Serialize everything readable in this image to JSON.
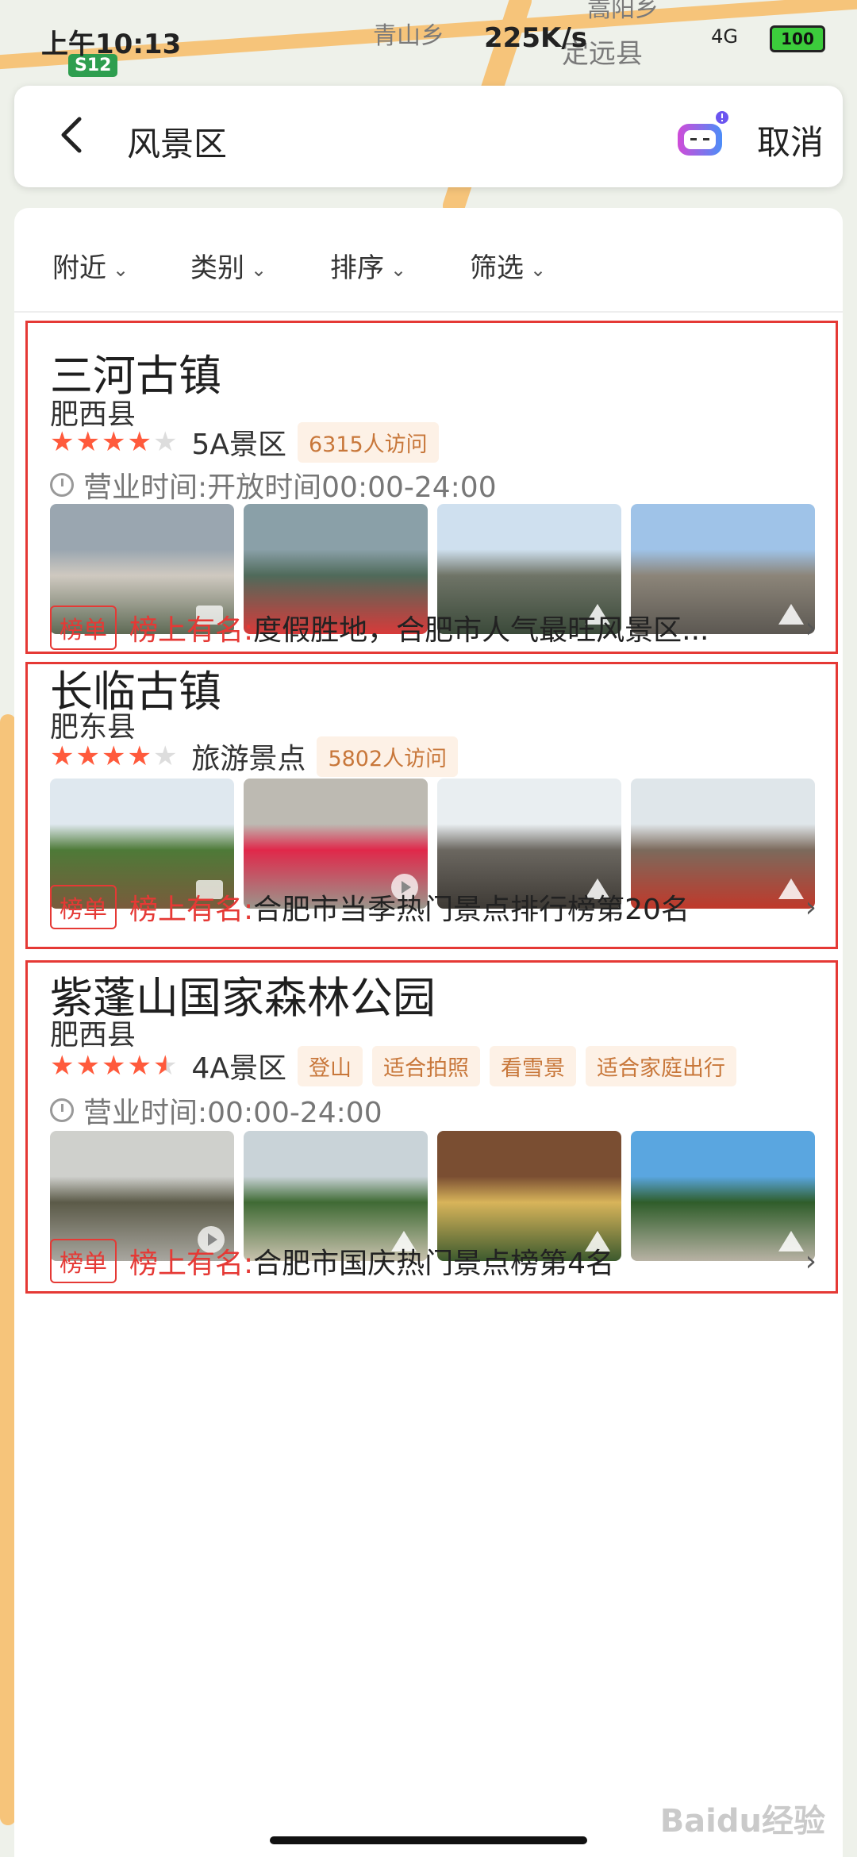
{
  "status_bar": {
    "time": "上午10:13",
    "network_speed": "225K/s",
    "signal": "4G",
    "battery": "100"
  },
  "map": {
    "labels": [
      "青山乡",
      "定远县",
      "嵩阳乡"
    ],
    "road_badge": "S12"
  },
  "header": {
    "title": "风景区",
    "cancel": "取消"
  },
  "filters": [
    "附近",
    "类别",
    "排序",
    "筛选"
  ],
  "results": [
    {
      "name": "三河古镇",
      "district": "肥西县",
      "rating": 4,
      "level": "5A景区",
      "chips": [
        "6315人访问"
      ],
      "hours": "营业时间:开放时间00:00-24:00",
      "photos": [
        {
          "colors": [
            "#9aa6b0",
            "#cfc9c0",
            "#5e6a55"
          ],
          "badge": "image"
        },
        {
          "colors": [
            "#8aa0a8",
            "#4f6a5a",
            "#d83a3a"
          ],
          "badge": "none"
        },
        {
          "colors": [
            "#cfe0ef",
            "#6f7467",
            "#3b4a3a"
          ],
          "badge": "mountain"
        },
        {
          "colors": [
            "#9fc3e8",
            "#8c8579",
            "#5c5852"
          ],
          "badge": "mountain"
        }
      ],
      "rank_tag": "榜单",
      "rank_label": "榜上有名:",
      "rank_text": "度假胜地，合肥市人气最旺风景区..."
    },
    {
      "name": "长临古镇",
      "district": "肥东县",
      "rating": 4,
      "level": "旅游景点",
      "chips": [
        "5802人访问"
      ],
      "hours": "",
      "photos": [
        {
          "colors": [
            "#dfe8ef",
            "#4e7a38",
            "#7a5b3c"
          ],
          "badge": "image"
        },
        {
          "colors": [
            "#bdbab2",
            "#e0284a",
            "#9a968c"
          ],
          "badge": "play"
        },
        {
          "colors": [
            "#e9eef1",
            "#6b6760",
            "#3e3a35"
          ],
          "badge": "mountain"
        },
        {
          "colors": [
            "#dfe6ea",
            "#7c6a5c",
            "#c0392b"
          ],
          "badge": "mountain"
        }
      ],
      "rank_tag": "榜单",
      "rank_label": "榜上有名:",
      "rank_text": "合肥市当季热门景点排行榜第20名"
    },
    {
      "name": "紫蓬山国家森林公园",
      "district": "肥西县",
      "rating": 4.5,
      "level": "4A景区",
      "chips": [
        "登山",
        "适合拍照",
        "看雪景",
        "适合家庭出行"
      ],
      "hours": "营业时间:00:00-24:00",
      "photos": [
        {
          "colors": [
            "#cfd0cc",
            "#5b5a48",
            "#a9a7a0"
          ],
          "badge": "play"
        },
        {
          "colors": [
            "#c9d3d8",
            "#3f6a34",
            "#c9c2ae"
          ],
          "badge": "mountain"
        },
        {
          "colors": [
            "#7a4e32",
            "#d8b45a",
            "#3c5a2e"
          ],
          "badge": "mountain"
        },
        {
          "colors": [
            "#5aa6e0",
            "#2f5d2a",
            "#b8b2a4"
          ],
          "badge": "mountain"
        }
      ],
      "rank_tag": "榜单",
      "rank_label": "榜上有名:",
      "rank_text": "合肥市国庆热门景点榜第4名"
    }
  ],
  "watermark": "Baidu经验"
}
